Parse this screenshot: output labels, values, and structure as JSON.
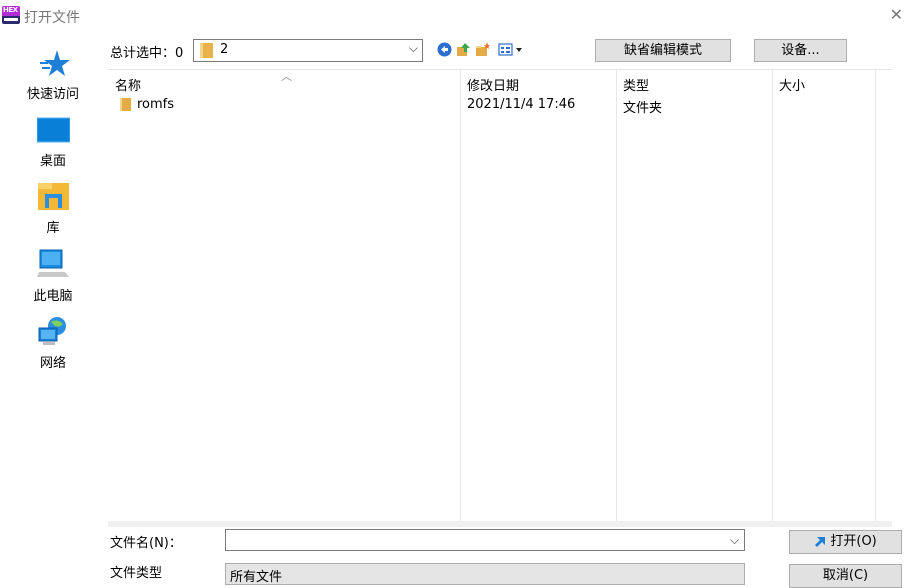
{
  "window": {
    "title": "打开文件",
    "app_icon": "hex-editor-icon"
  },
  "places": [
    {
      "label": "快速访问",
      "icon": "star-icon"
    },
    {
      "label": "桌面",
      "icon": "desktop-icon"
    },
    {
      "label": "库",
      "icon": "library-icon"
    },
    {
      "label": "此电脑",
      "icon": "computer-icon"
    },
    {
      "label": "网络",
      "icon": "network-icon"
    }
  ],
  "toolbar": {
    "selected_label": "总计选中：0",
    "look_in": "2",
    "missing_edit_mode": "缺省编辑模式",
    "settings": "设备..."
  },
  "list": {
    "columns": [
      "名称",
      "修改日期",
      "类型",
      "大小"
    ],
    "rows": [
      {
        "name": "romfs",
        "modified": "2021/11/4 17:46",
        "type": "文件夹",
        "size": ""
      }
    ]
  },
  "footer": {
    "filename_label": "文件名(N)：",
    "filename_value": "",
    "open_button": "打开(O)",
    "filetype_label": "文件类型",
    "filetype_value": "所有文件",
    "cancel_button": "取消(C)"
  },
  "colors": {
    "accent": "#1e90ff",
    "folder": "#e5ac45",
    "button": "#e1e1e1"
  }
}
